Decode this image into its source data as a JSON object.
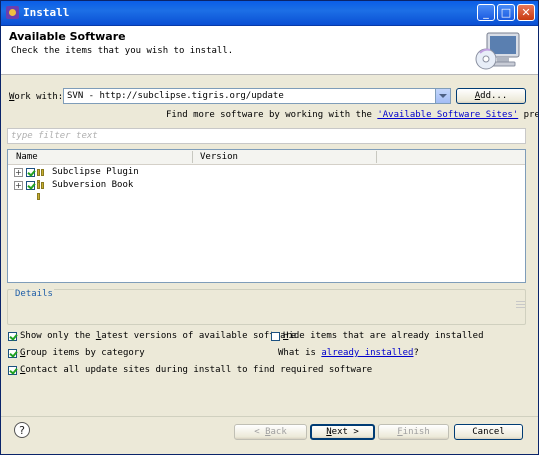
{
  "window": {
    "title": "Install"
  },
  "banner": {
    "title": "Available Software",
    "description": "Check the items that you wish to install.",
    "icon": "computer-cd-icon"
  },
  "work_with": {
    "label_prefix": "W",
    "label_rest": "ork with:",
    "value": "SVN - http://subclipse.tigris.org/update",
    "add_button_prefix": "A",
    "add_button_rest": "dd..."
  },
  "find_more": {
    "prefix": "Find more software by working with the ",
    "link": "'Available Software Sites'",
    "suffix": " preferences."
  },
  "filter": {
    "placeholder": "type filter text"
  },
  "tree": {
    "columns": [
      "Name",
      "Version"
    ],
    "rows": [
      {
        "name": "Subclipse Plugin",
        "version": "",
        "checked": true
      },
      {
        "name": "Subversion Book",
        "version": "",
        "checked": true
      }
    ]
  },
  "details": {
    "label": "Details"
  },
  "options": {
    "latest_prefix": "Show only the ",
    "latest_u": "l",
    "latest_rest": "atest versions of available software",
    "latest_checked": true,
    "hide_u": "H",
    "hide_rest": "ide items that are already installed",
    "hide_checked": false,
    "group_u": "G",
    "group_rest": "roup items by category",
    "group_checked": true,
    "whatis_prefix": "What is ",
    "whatis_link": "already installed",
    "whatis_suffix": "?",
    "contact_u": "C",
    "contact_rest": "ontact all update sites during install to find required software",
    "contact_checked": true
  },
  "footer": {
    "back_pre": "< ",
    "back_u": "B",
    "back_rest": "ack",
    "next_u": "N",
    "next_rest": "ext >",
    "finish_u": "F",
    "finish_rest": "inish",
    "cancel": "Cancel",
    "help_symbol": "?"
  }
}
